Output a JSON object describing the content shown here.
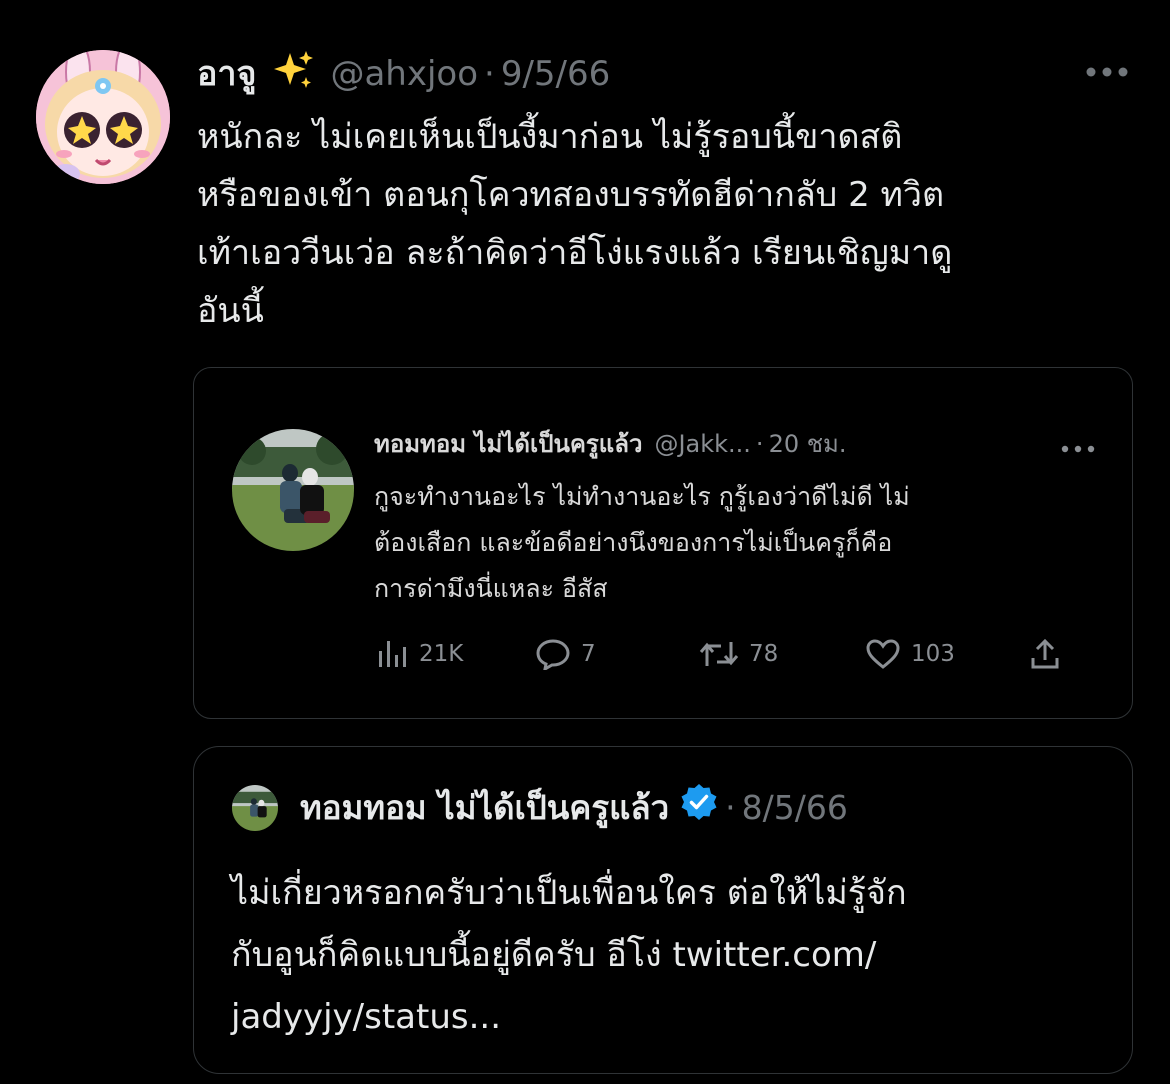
{
  "tweet": {
    "display_name": "อาจู",
    "sparkle_icon": "sparkles-icon",
    "handle": "@ahxjoo",
    "separator": "·",
    "date": "9/5/66",
    "text_lines": [
      "หนักละ ไม่เคยเห็นเป็นงี้มาก่อน ไม่รู้รอบนี้ขาดสติ",
      "หรือของเข้า ตอนกุโควทสองบรรทัดฮีด่ากลับ 2 ทวิต",
      "เท้าเอววีนเว่อ ละถ้าคิดว่าอีโง่แรงแล้ว เรียนเชิญมาดู",
      "อันนี้"
    ]
  },
  "screenshot": {
    "display_name": "ทอมทอม ไม่ได้เป็นครูแล้ว",
    "handle": "@Jakk...",
    "separator": "·",
    "date": "20 ชม.",
    "text_lines": [
      "กูจะทำงานอะไร ไม่ทำงานอะไร กูรู้เองว่าดีไม่ดี ไม่",
      "ต้องเสือก และข้อดีอย่างนึงของการไม่เป็นครูก็คือ",
      "การด่ามึงนี่แหละ อีสัส"
    ],
    "actions": {
      "views": "21K",
      "replies": "7",
      "retweets": "78",
      "likes": "103"
    }
  },
  "quote": {
    "display_name": "ทอมทอม ไม่ได้เป็นครูแล้ว",
    "verified_color": "#1d9bf0",
    "separator": "·",
    "date": "8/5/66",
    "text_lines": [
      "ไม่เกี่ยวหรอกครับว่าเป็นเพื่อนใคร ต่อให้ไม่รู้จัก",
      "กับอูนก็คิดแบบนี้อยู่ดีครับ อีโง่ twitter.com/",
      "jadyyjy/status..."
    ]
  },
  "colors": {
    "background": "#000000",
    "text_primary": "#e7e9ea",
    "text_secondary": "#71767b",
    "border": "#2f3336",
    "accent": "#1d9bf0"
  }
}
